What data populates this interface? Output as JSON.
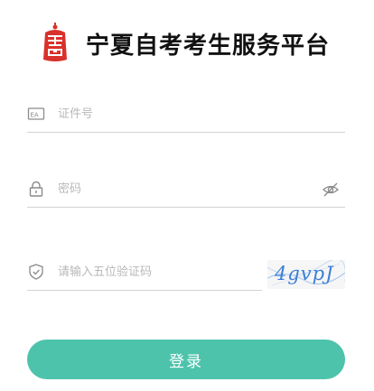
{
  "header": {
    "title": "宁夏自考考生服务平台",
    "logo_icon": "seal-logo-icon",
    "logo_color": "#d9312b"
  },
  "form": {
    "id_field": {
      "icon": "id-card-icon",
      "placeholder": "证件号",
      "value": ""
    },
    "password_field": {
      "icon": "lock-icon",
      "placeholder": "密码",
      "value": "",
      "toggle_icon": "eye-off-icon"
    },
    "captcha_field": {
      "icon": "shield-check-icon",
      "placeholder": "请输入五位验证码",
      "value": "",
      "captcha_text": "4gvpJ"
    },
    "login_label": "登录"
  },
  "colors": {
    "accent": "#4ec3ac",
    "divider": "#d3d3d3",
    "placeholder": "#b8b8b8",
    "captcha_text": "#3b7fd6"
  }
}
